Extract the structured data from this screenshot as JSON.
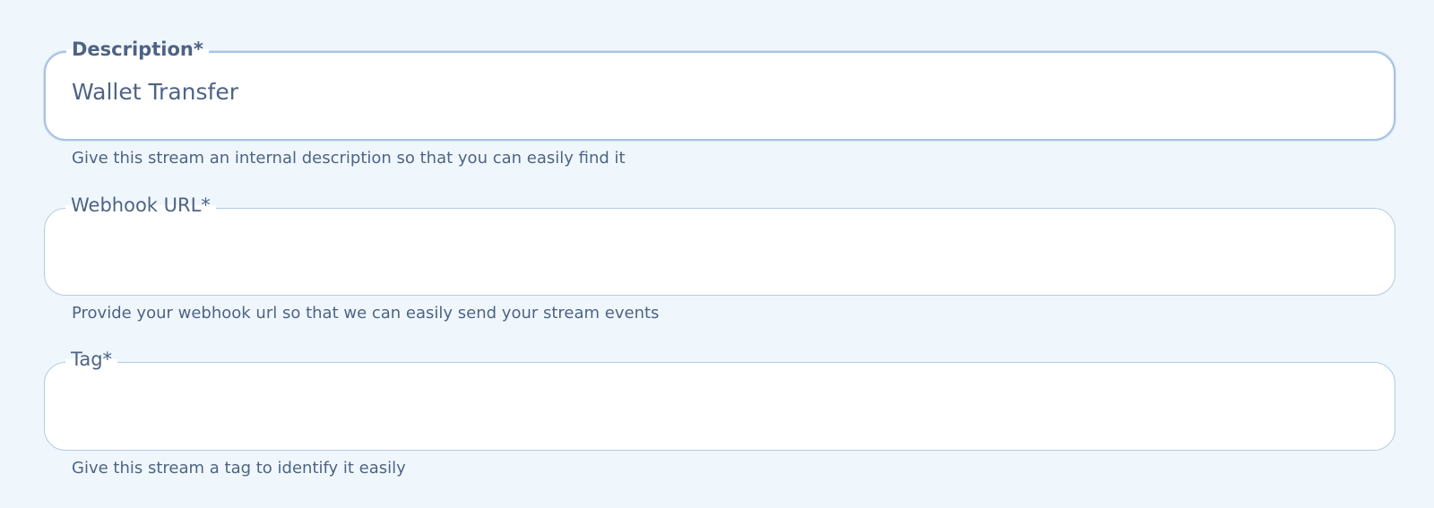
{
  "form": {
    "description": {
      "label": "Description*",
      "value": "Wallet Transfer",
      "placeholder": "",
      "helper": "Give this stream an internal description so that you can easily find it"
    },
    "webhook_url": {
      "label": "Webhook URL*",
      "value": "",
      "placeholder": "",
      "helper": "Provide your webhook url so that we can easily send your stream events"
    },
    "tag": {
      "label": "Tag*",
      "value": "",
      "placeholder": "",
      "helper": "Give this stream a tag to identify it easily"
    }
  },
  "colors": {
    "background": "#eff7fd",
    "field_background": "#ffffff",
    "border": "#b4cbe2",
    "focused_border": "#a9c3e4",
    "text": "#4f6385"
  }
}
